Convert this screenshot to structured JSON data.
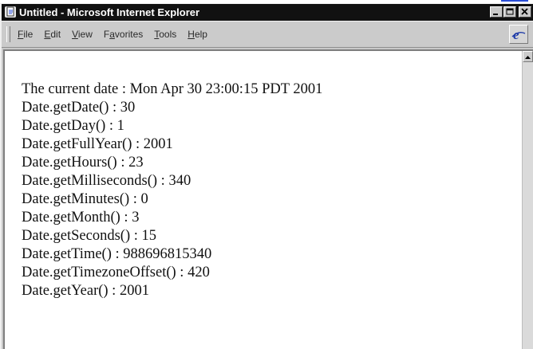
{
  "window": {
    "title": "Untitled - Microsoft Internet Explorer"
  },
  "menubar": {
    "items": [
      {
        "label": "File",
        "accel": "F",
        "rest": "ile"
      },
      {
        "label": "Edit",
        "accel": "E",
        "rest": "dit"
      },
      {
        "label": "View",
        "accel": "V",
        "rest": "iew"
      },
      {
        "label": "Favorites",
        "pre": "F",
        "accel": "a",
        "rest": "vorites"
      },
      {
        "label": "Tools",
        "accel": "T",
        "rest": "ools"
      },
      {
        "label": "Help",
        "accel": "H",
        "rest": "elp"
      }
    ]
  },
  "page": {
    "lines": [
      "The current date : Mon Apr 30 23:00:15 PDT 2001",
      "Date.getDate() : 30",
      "Date.getDay() : 1",
      "Date.getFullYear() : 2001",
      "Date.getHours() : 23",
      "Date.getMilliseconds() : 340",
      "Date.getMinutes() : 0",
      "Date.getMonth() : 3",
      "Date.getSeconds() : 15",
      "Date.getTime() : 988696815340",
      "Date.getTimezoneOffset() : 420",
      "Date.getYear() : 2001"
    ]
  },
  "icons": {
    "app": "ie-page-icon",
    "minimize": "minimize-icon",
    "maximize": "maximize-icon",
    "close": "close-icon",
    "throbber": "ie-logo-icon",
    "scroll_up": "scroll-up-arrow-icon"
  },
  "colors": {
    "titlebar": "#111111",
    "chrome": "#c9c9c9",
    "link_sliver": "#2a4ed8"
  }
}
